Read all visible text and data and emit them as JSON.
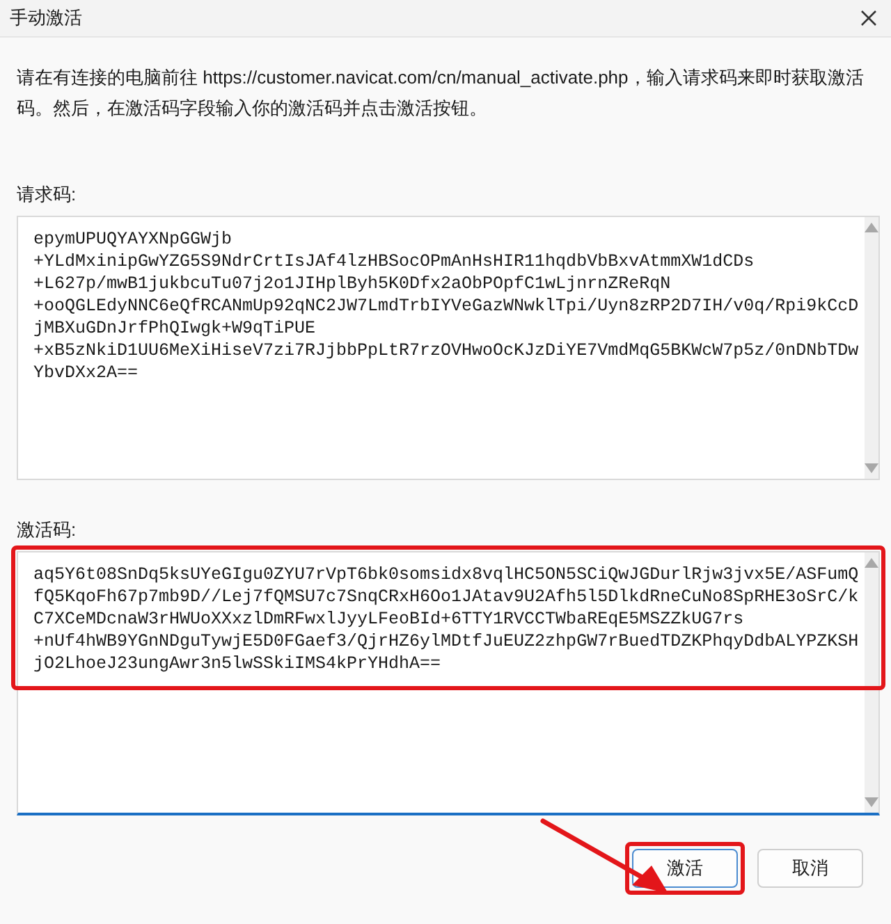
{
  "window": {
    "title": "手动激活"
  },
  "instructions": "请在有连接的电脑前往 https://customer.navicat.com/cn/manual_activate.php，输入请求码来即时获取激活码。然后，在激活码字段输入你的激活码并点击激活按钮。",
  "request_code": {
    "label": "请求码:",
    "lines": [
      "epymUPUQYAYXNpGGWjb",
      "+YLdMxinipGwYZG5S9NdrCrtIsJAf4lzHBSocOPmAnHsHIR11hqdbVbBxvAtmmXW1dCDs",
      "+L627p/mwB1jukbcuTu07j2o1JIHplByh5K0Dfx2aObPOpfC1wLjnrnZReRqN",
      "+ooQGLEdyNNC6eQfRCANmUp92qNC2JW7LmdTrbIYVeGazWNwklTpi/Uyn8zRP2D7IH/v0q/Rpi9kCcD",
      "jMBXuGDnJrfPhQIwgk+W9qTiPUE",
      "+xB5zNkiD1UU6MeXiHiseV7zi7RJjbbPpLtR7rzOVHwoOcKJzDiYE7VmdMqG5BKWcW7p5z/0nDNbTDw",
      "YbvDXx2A=="
    ]
  },
  "activation_code": {
    "label": "激活码:",
    "focused": true,
    "highlighted": true,
    "lines": [
      "aq5Y6t08SnDq5ksUYeGIgu0ZYU7rVpT6bk0somsidx8vqlHC5ON5SCiQwJGDurlRjw3jvx5E/ASFumQ",
      "fQ5KqoFh67p7mb9D//Lej7fQMSU7c7SnqCRxH6Oo1JAtav9U2Afh5l5DlkdRneCuNo8SpRHE3oSrC/k",
      "C7XCeMDcnaW3rHWUoXXxzlDmRFwxlJyyLFeoBId+6TTY1RVCCTWbaREqE5MSZZkUG7rs",
      "+nUf4hWB9YGnNDguTywjE5D0FGaef3/QjrHZ6ylMDtfJuEUZ2zhpGW7rBuedTDZKPhqyDdbALYPZKSH",
      "jO2LhoeJ23ungAwr3n5lwSSkiIMS4kPrYHdhA=="
    ]
  },
  "buttons": [
    {
      "label": "激活",
      "highlighted": true
    },
    {
      "label": "取消",
      "highlighted": false
    }
  ]
}
